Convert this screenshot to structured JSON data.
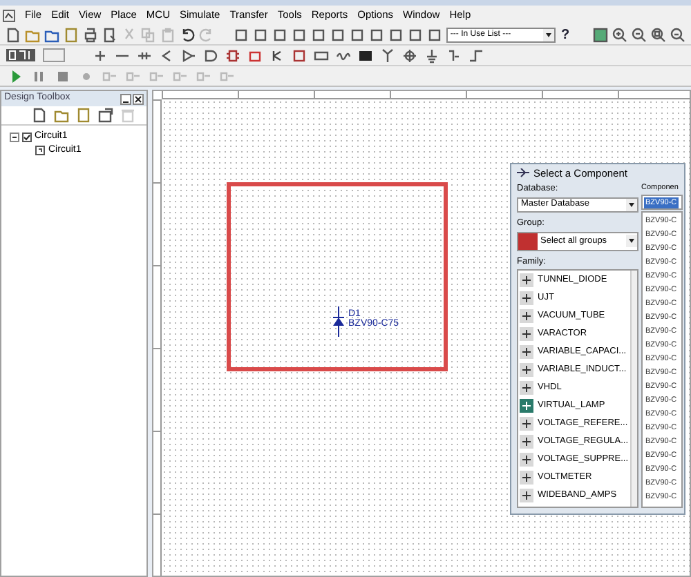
{
  "menu": [
    "File",
    "Edit",
    "View",
    "Place",
    "MCU",
    "Simulate",
    "Transfer",
    "Tools",
    "Reports",
    "Options",
    "Window",
    "Help"
  ],
  "toolbar": {
    "in_use_list": "--- In Use List ---",
    "help": "?"
  },
  "design_toolbox": {
    "title": "Design Toolbox",
    "tree": [
      {
        "label": "Circuit1",
        "expanded": true,
        "children": [
          {
            "label": "Circuit1"
          }
        ]
      }
    ]
  },
  "schematic": {
    "component": {
      "ref": "D1",
      "value": "BZV90-C75"
    }
  },
  "dialog": {
    "title": "Select a Component",
    "database_label": "Database:",
    "database": "Master Database",
    "group_label": "Group:",
    "group": "Select all groups",
    "family_label": "Family:",
    "families": [
      "TUNNEL_DIODE",
      "UJT",
      "VACUUM_TUBE",
      "VARACTOR",
      "VARIABLE_CAPACI...",
      "VARIABLE_INDUCT...",
      "VHDL",
      "VIRTUAL_LAMP",
      "VOLTAGE_REFERE...",
      "VOLTAGE_REGULA...",
      "VOLTAGE_SUPPRE...",
      "VOLTMETER",
      "WIDEBAND_AMPS"
    ],
    "component_label": "Componen",
    "component_field": "BZV90-C",
    "components": [
      "BZV90-C",
      "BZV90-C",
      "BZV90-C",
      "BZV90-C",
      "BZV90-C",
      "BZV90-C",
      "BZV90-C",
      "BZV90-C",
      "BZV90-C",
      "BZV90-C",
      "BZV90-C",
      "BZV90-C",
      "BZV90-C",
      "BZV90-C",
      "BZV90-C",
      "BZV90-C",
      "BZV90-C",
      "BZV90-C",
      "BZV90-C",
      "BZV90-C",
      "BZV90-C"
    ]
  }
}
